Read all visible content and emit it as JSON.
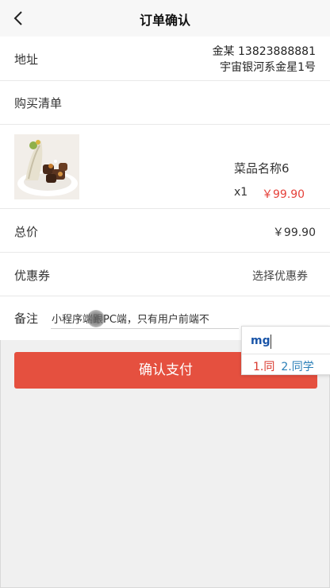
{
  "navbar": {
    "title": "订单确认",
    "back_icon": "chevron-left-icon"
  },
  "address": {
    "label": "地址",
    "line1": "金某 13823888881",
    "line2": "宇宙银河系金星1号"
  },
  "cart": {
    "label": "购买清单",
    "items": [
      {
        "name": "菜品名称6",
        "qty": "x1",
        "price": "￥99.90"
      }
    ]
  },
  "total": {
    "label": "总价",
    "value": "￥99.90"
  },
  "coupon": {
    "label": "优惠券",
    "action": "选择优惠券"
  },
  "remark": {
    "label": "备注",
    "value": "小程序端跟PC端，只有用户前端不"
  },
  "pay_button": {
    "label": "确认支付"
  },
  "ime": {
    "composition": "mg",
    "candidates": [
      {
        "index": "1.",
        "text": "同"
      },
      {
        "index": "2.",
        "text": "同学"
      }
    ]
  },
  "colors": {
    "accent": "#e5503f",
    "price": "#e5413a",
    "ime_composition": "#1a55a8",
    "ime_candidate_active": "#d9362b",
    "ime_candidate": "#2a7fb8"
  }
}
